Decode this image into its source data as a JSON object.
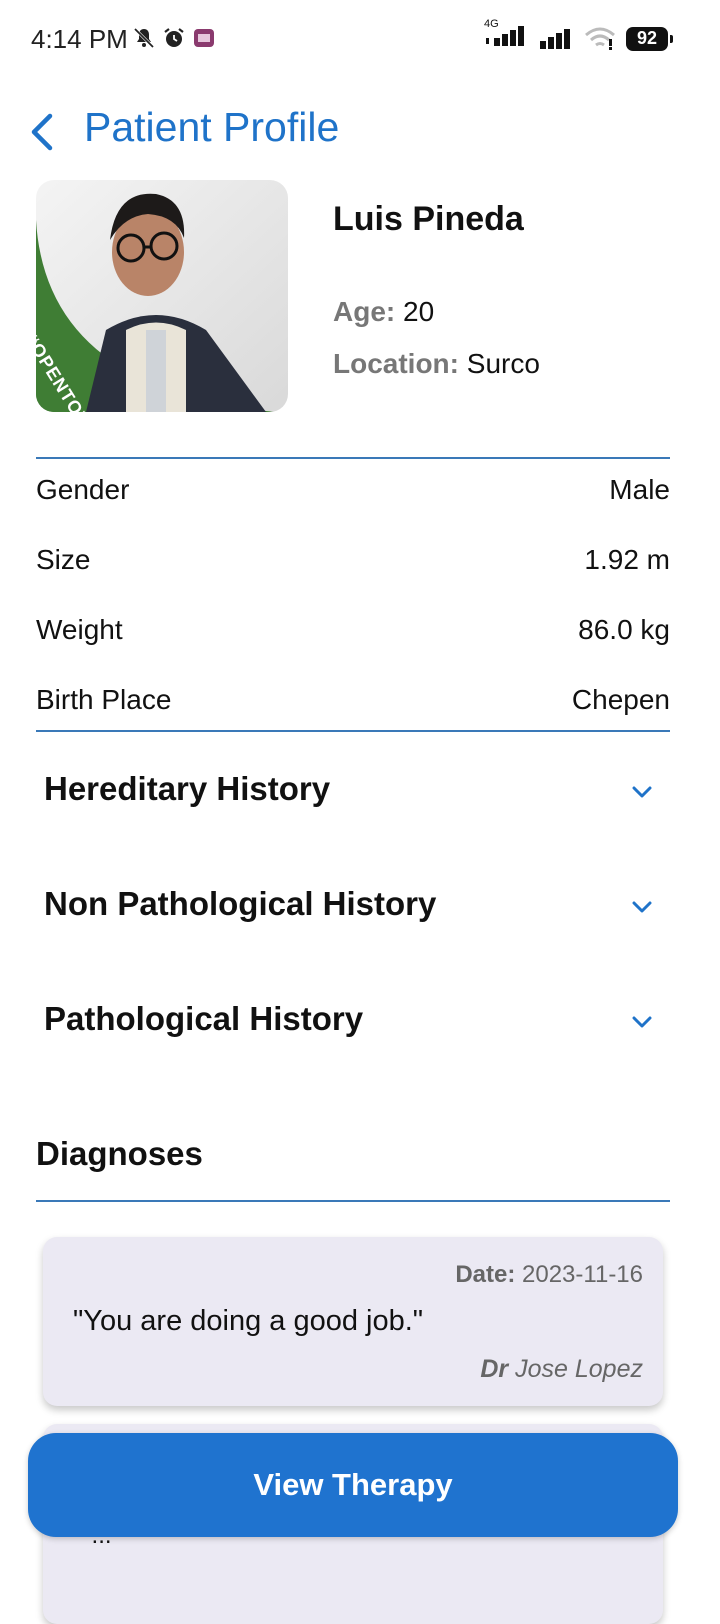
{
  "status_bar": {
    "time": "4:14 PM",
    "network": "4G",
    "battery": "92"
  },
  "app_bar": {
    "title": "Patient Profile"
  },
  "profile": {
    "name": "Luis Pineda",
    "age_label": "Age:",
    "age": "20",
    "location_label": "Location:",
    "location": "Surco",
    "photo_badge": "#OPENTOWORK"
  },
  "details": [
    {
      "label": "Gender",
      "value": "Male"
    },
    {
      "label": "Size",
      "value": "1.92 m"
    },
    {
      "label": "Weight",
      "value": "86.0 kg"
    },
    {
      "label": "Birth Place",
      "value": "Chepen"
    }
  ],
  "accordions": [
    {
      "title": "Hereditary History"
    },
    {
      "title": "Non Pathological History"
    },
    {
      "title": "Pathological History"
    }
  ],
  "diagnoses": {
    "title": "Diagnoses",
    "items": [
      {
        "date_label": "Date:",
        "date": "2023-11-16",
        "note": "\"You are doing a good job.\"",
        "doctor_prefix": "Dr",
        "doctor": "Jose Lopez"
      },
      {
        "partial_text": "\"..."
      }
    ]
  },
  "actions": {
    "view_therapy": "View Therapy"
  },
  "colors": {
    "accent": "#1f73c9",
    "button": "#1f73cf",
    "divider": "#3a79b8",
    "card_bg": "#ebe9f3",
    "badge_green": "#3f7d34"
  }
}
